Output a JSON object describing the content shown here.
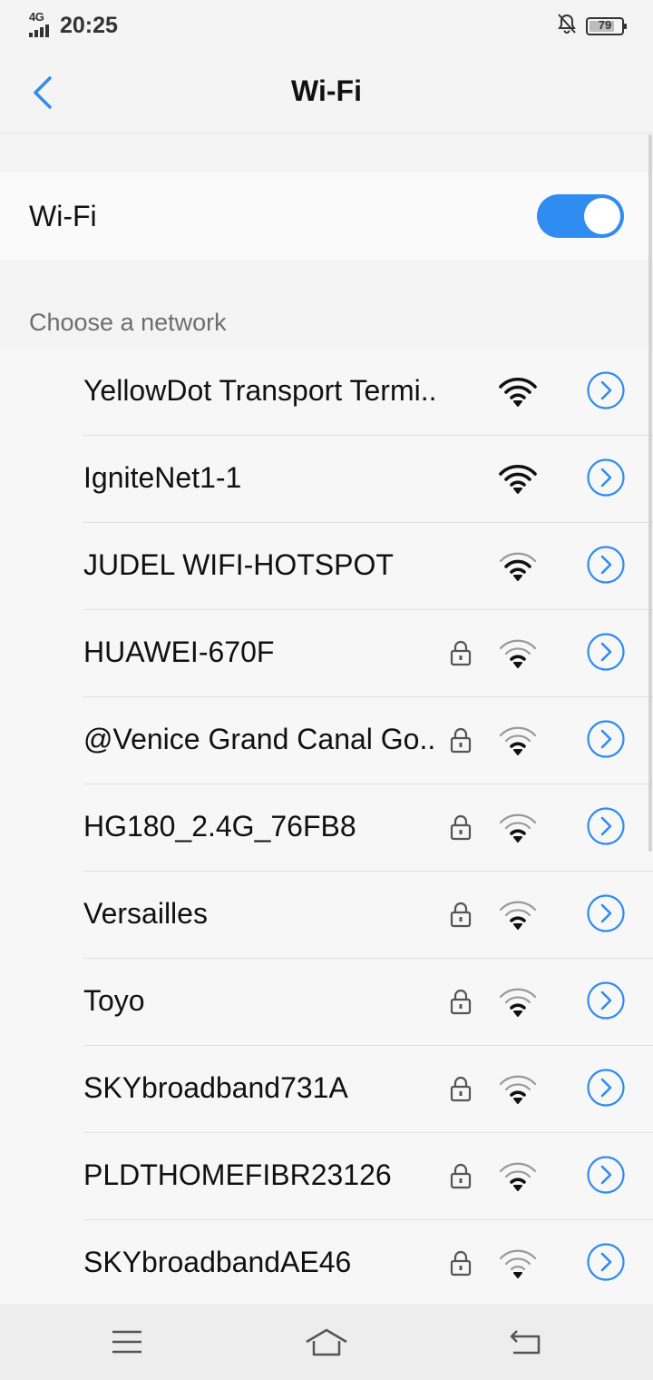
{
  "status_bar": {
    "network": "4G",
    "time": "20:25",
    "battery": "79",
    "icons": [
      "signal-icon",
      "bell-muted-icon",
      "battery-icon"
    ]
  },
  "header": {
    "title": "Wi-Fi"
  },
  "wifi_toggle": {
    "label": "Wi-Fi",
    "on": true,
    "accent": "#2f8cf0"
  },
  "section": {
    "label": "Choose a network"
  },
  "networks": [
    {
      "name": "YellowDot Transport Termi..",
      "locked": false,
      "signal": 4
    },
    {
      "name": "IgniteNet1-1",
      "locked": false,
      "signal": 4
    },
    {
      "name": "JUDEL WIFI-HOTSPOT",
      "locked": false,
      "signal": 3
    },
    {
      "name": "HUAWEI-670F",
      "locked": true,
      "signal": 2
    },
    {
      "name": "@Venice Grand Canal Go..",
      "locked": true,
      "signal": 2
    },
    {
      "name": "HG180_2.4G_76FB8",
      "locked": true,
      "signal": 2
    },
    {
      "name": "Versailles",
      "locked": true,
      "signal": 2
    },
    {
      "name": "Toyo",
      "locked": true,
      "signal": 2
    },
    {
      "name": "SKYbroadband731A",
      "locked": true,
      "signal": 2
    },
    {
      "name": "PLDTHOMEFIBR23126",
      "locked": true,
      "signal": 2
    },
    {
      "name": "SKYbroadbandAE46",
      "locked": true,
      "signal": 1
    }
  ],
  "navbar": {
    "icons": [
      "menu-icon",
      "home-icon",
      "back-icon"
    ]
  }
}
